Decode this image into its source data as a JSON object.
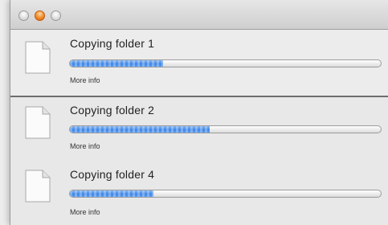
{
  "window": {
    "controls": [
      "close",
      "minimize",
      "zoom"
    ]
  },
  "items": [
    {
      "title": "Copying folder 1",
      "progress": 0.3,
      "more_info": "More info"
    },
    {
      "title": "Copying folder 2",
      "progress": 0.45,
      "more_info": "More info"
    },
    {
      "title": "Copying folder 4",
      "progress": 0.27,
      "more_info": "More info"
    }
  ],
  "colors": {
    "progress_fill": "#3f86e6",
    "track": "#ffffff",
    "divider": "#6d6d6d"
  },
  "icons": {
    "file": "document-icon"
  }
}
